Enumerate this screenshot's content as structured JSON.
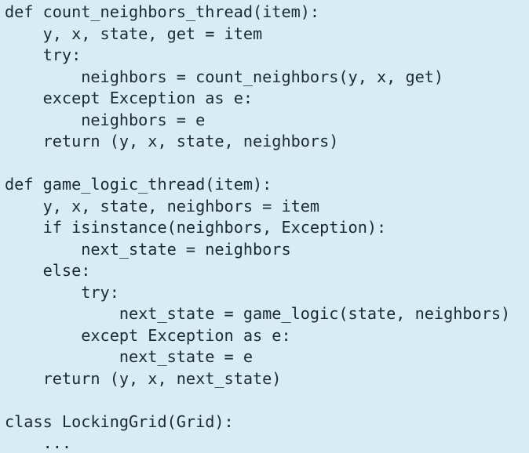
{
  "code": {
    "lines": [
      "def count_neighbors_thread(item):",
      "    y, x, state, get = item",
      "    try:",
      "        neighbors = count_neighbors(y, x, get)",
      "    except Exception as e:",
      "        neighbors = e",
      "    return (y, x, state, neighbors)",
      "",
      "def game_logic_thread(item):",
      "    y, x, state, neighbors = item",
      "    if isinstance(neighbors, Exception):",
      "        next_state = neighbors",
      "    else:",
      "        try:",
      "            next_state = game_logic(state, neighbors)",
      "        except Exception as e:",
      "            next_state = e",
      "    return (y, x, next_state)",
      "",
      "class LockingGrid(Grid):",
      "    ..."
    ]
  }
}
